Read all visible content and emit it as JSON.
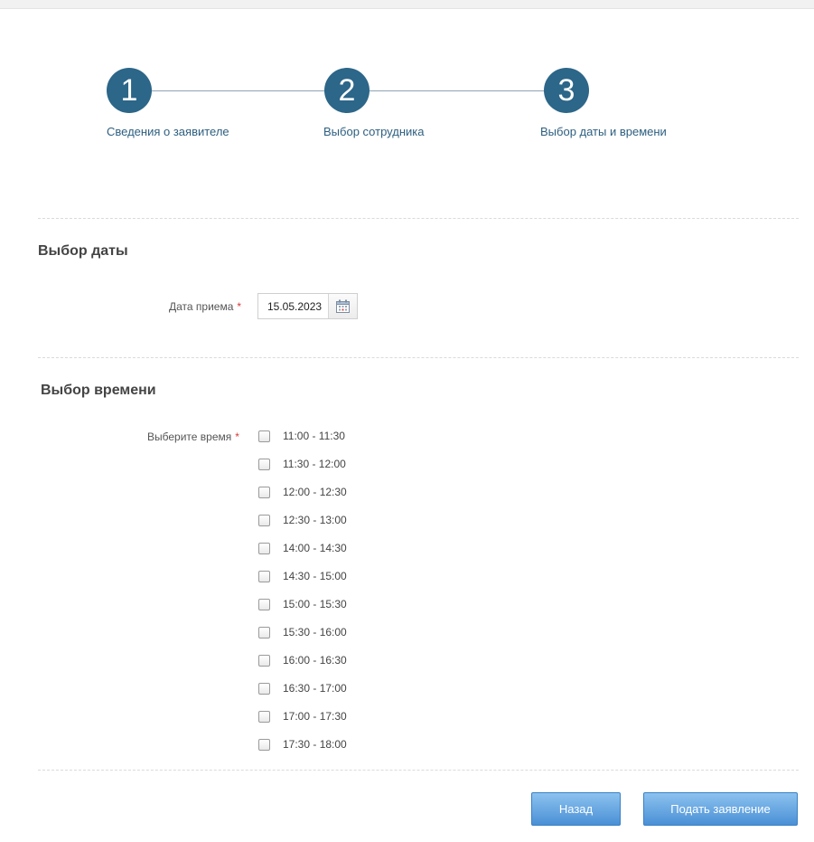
{
  "steps": [
    {
      "number": "1",
      "label": "Сведения о заявителе"
    },
    {
      "number": "2",
      "label": "Выбор сотрудника"
    },
    {
      "number": "3",
      "label": "Выбор даты и времени"
    }
  ],
  "date_section": {
    "title": "Выбор даты",
    "field_label": "Дата приема",
    "required_mark": "*",
    "value": "15.05.2023",
    "calendar_icon": "calendar-icon"
  },
  "time_section": {
    "title": "Выбор времени",
    "field_label": "Выберите время",
    "required_mark": "*",
    "slots": [
      "11:00 - 11:30",
      "11:30 - 12:00",
      "12:00 - 12:30",
      "12:30 - 13:00",
      "14:00 - 14:30",
      "14:30 - 15:00",
      "15:00 - 15:30",
      "15:30 - 16:00",
      "16:00 - 16:30",
      "16:30 - 17:00",
      "17:00 - 17:30",
      "17:30 - 18:00"
    ]
  },
  "actions": {
    "back_label": "Назад",
    "submit_label": "Подать заявление"
  },
  "colors": {
    "step_accent": "#2c6688",
    "button_accent": "#4a90d6",
    "required": "#d63a3a"
  }
}
